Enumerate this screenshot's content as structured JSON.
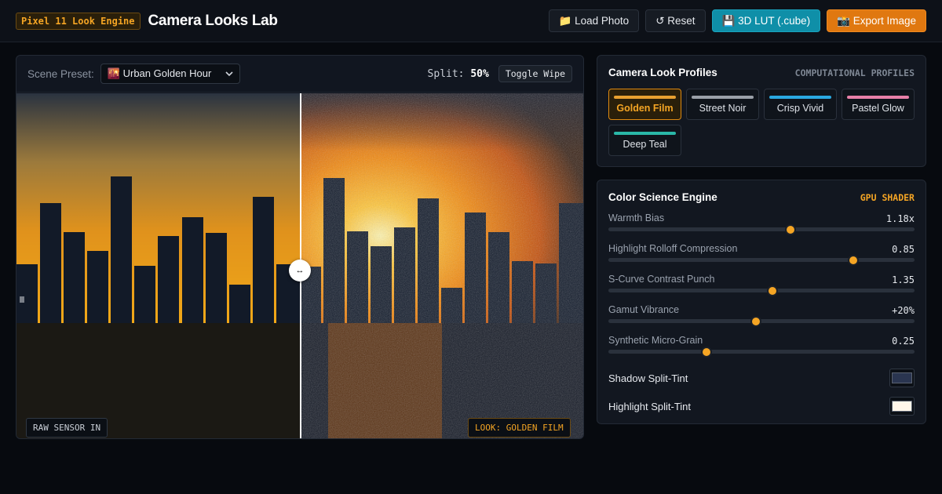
{
  "header": {
    "badge": "Pixel 11 Look Engine",
    "title": "Camera Looks Lab",
    "buttons": {
      "load": "📁 Load Photo",
      "reset": "↺ Reset",
      "lut": "💾 3D LUT (.cube)",
      "export": "📸 Export Image"
    }
  },
  "viewer": {
    "preset_label": "Scene Preset:",
    "preset_value": "🌇 Urban Golden Hour",
    "split_label": "Split:",
    "split_value": "50%",
    "toggle_label": "Toggle Wipe",
    "handle_glyph": "↔",
    "tag_left": "RAW SENSOR IN",
    "tag_right": "LOOK: GOLDEN FILM"
  },
  "profiles": {
    "title": "Camera Look Profiles",
    "subtitle": "COMPUTATIONAL PROFILES",
    "items": [
      {
        "name": "Golden Film",
        "color": "#e8a030",
        "active": true
      },
      {
        "name": "Street Noir",
        "color": "#9aa0a8",
        "active": false
      },
      {
        "name": "Crisp Vivid",
        "color": "#2aa8e0",
        "active": false
      },
      {
        "name": "Pastel Glow",
        "color": "#e880a8",
        "active": false
      },
      {
        "name": "Deep Teal",
        "color": "#2ab8a8",
        "active": false
      }
    ]
  },
  "engine": {
    "title": "Color Science Engine",
    "subtitle": "GPU SHADER",
    "sliders": [
      {
        "label": "Warmth Bias",
        "value": "1.18x",
        "level": 0.595
      },
      {
        "label": "Highlight Rolloff Compression",
        "value": "0.85",
        "level": 0.8
      },
      {
        "label": "S-Curve Contrast Punch",
        "value": "1.35",
        "level": 0.535
      },
      {
        "label": "Gamut Vibrance",
        "value": "+20%",
        "level": 0.482
      },
      {
        "label": "Synthetic Micro-Grain",
        "value": "0.25",
        "level": 0.32
      }
    ],
    "tints": [
      {
        "label": "Shadow Split-Tint",
        "color": "#2a3550"
      },
      {
        "label": "Highlight Split-Tint",
        "color": "#fff6ea"
      }
    ]
  }
}
